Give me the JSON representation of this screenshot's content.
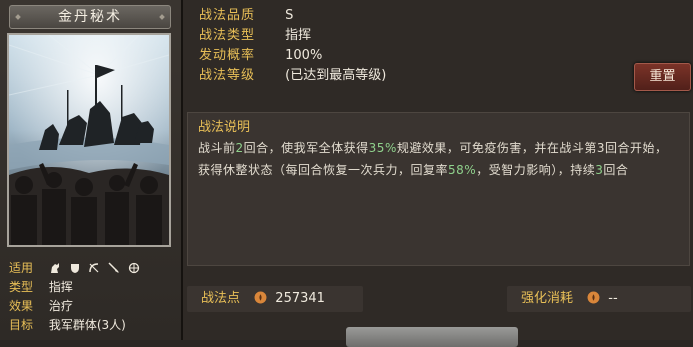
{
  "tactic": {
    "name": "金丹秘术"
  },
  "usage": {
    "label": "适用",
    "unit_icons": [
      "cavalry-icon",
      "shield-icon",
      "archer-icon",
      "spear-icon",
      "siege-icon"
    ]
  },
  "attributes": [
    {
      "key": "类型",
      "value": "指挥"
    },
    {
      "key": "效果",
      "value": "治疗"
    },
    {
      "key": "目标",
      "value": "我军群体(3人)"
    }
  ],
  "info": {
    "quality_label": "战法品质",
    "quality": "S",
    "type_label": "战法类型",
    "type": "指挥",
    "rate_label": "发动概率",
    "rate": "100%",
    "level_label": "战法等级",
    "level": "(已达到最高等级)"
  },
  "reset_button": "重置",
  "description": {
    "title": "战法说明",
    "segments": [
      {
        "text": "战斗前",
        "hl": false
      },
      {
        "text": "2",
        "hl": true
      },
      {
        "text": "回合，使我军全体获得",
        "hl": false
      },
      {
        "text": "35%",
        "hl": true
      },
      {
        "text": "规避效果，可免疫伤害，并在战斗第",
        "hl": false
      },
      {
        "text": "3",
        "hl": false
      },
      {
        "text": "回合开始，获得休整状态（每回合恢复一次兵力，回复率",
        "hl": false
      },
      {
        "text": "58%",
        "hl": true
      },
      {
        "text": "，受智力影响），持续",
        "hl": false
      },
      {
        "text": "3",
        "hl": true
      },
      {
        "text": "回合",
        "hl": false
      }
    ]
  },
  "points": {
    "label": "战法点",
    "value": "257341"
  },
  "upgrade_cost": {
    "label": "强化消耗",
    "value": "--"
  },
  "colors": {
    "accent_gold": "#e8bf57",
    "highlight_green": "#8fd18c",
    "reset_red": "#7b3328"
  }
}
